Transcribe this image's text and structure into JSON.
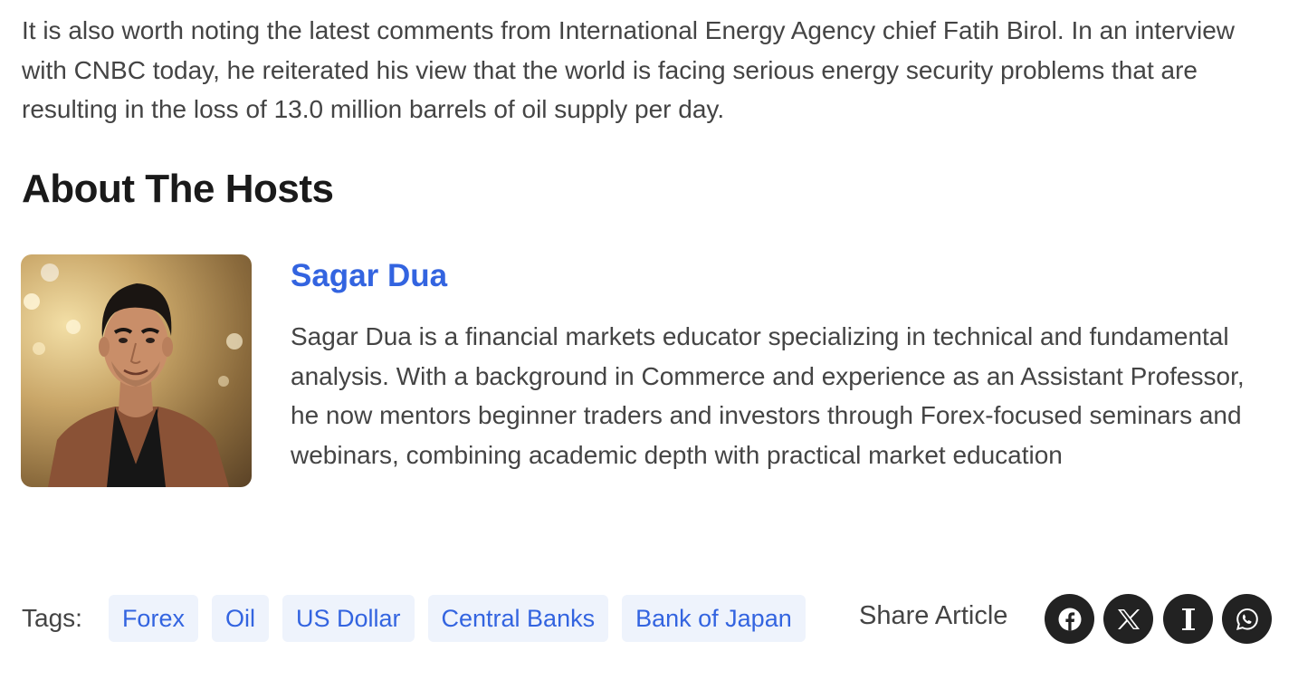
{
  "article": {
    "intro_paragraph": "It is also worth noting the latest comments from International Energy Agency chief Fatih Birol. In an interview with CNBC today, he reiterated his view that the world is facing serious energy security problems that are resulting in the loss of 13.0 million barrels of oil supply per day."
  },
  "hosts_section": {
    "title": "About The Hosts",
    "host": {
      "name": "Sagar Dua",
      "bio": "Sagar Dua is a financial markets educator specializing in technical and fundamental analysis. With a background in Commerce and experience as an Assistant Professor, he now mentors beginner traders and investors through Forex-focused seminars and webinars, combining academic depth with practical market education",
      "photo_icon": "host-portrait"
    }
  },
  "tags": {
    "label": "Tags:",
    "items": [
      "Forex",
      "Oil",
      "US Dollar",
      "Central Banks",
      "Bank of Japan"
    ]
  },
  "share": {
    "label": "Share Article",
    "buttons": [
      "facebook-icon",
      "x-icon",
      "instapaper-icon",
      "whatsapp-icon"
    ]
  },
  "colors": {
    "accent": "#3364e0",
    "tag_background": "#eef3fc",
    "share_button": "#222222",
    "body_text": "#444444",
    "heading": "#1a1a1a"
  }
}
